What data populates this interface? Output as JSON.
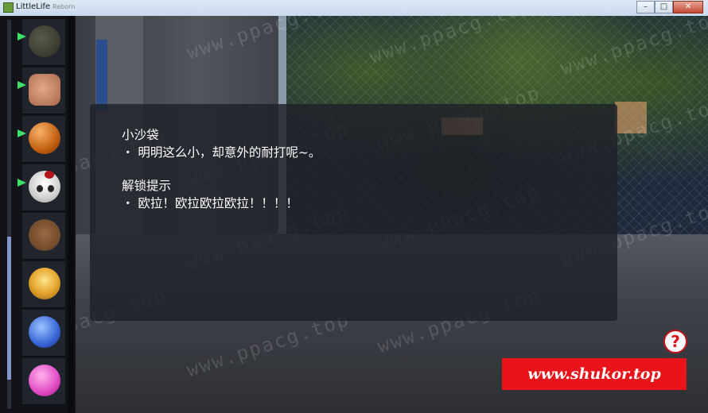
{
  "window": {
    "title": "LittleLife",
    "subtitle": "Reborn"
  },
  "sidebar": {
    "items": [
      {
        "icon": "helmet-icon",
        "unlocked": true
      },
      {
        "icon": "fist-icon",
        "unlocked": true
      },
      {
        "icon": "sandbag-ball-icon",
        "unlocked": true
      },
      {
        "icon": "skull-icon",
        "unlocked": true
      },
      {
        "icon": "teddy-bear-icon",
        "unlocked": false
      },
      {
        "icon": "explosion-icon",
        "unlocked": false
      },
      {
        "icon": "blue-face-icon",
        "unlocked": false
      },
      {
        "icon": "pink-face-icon",
        "unlocked": false
      }
    ],
    "scroll_fraction": 0.55
  },
  "message": {
    "item_name": "小沙袋",
    "description": "・ 明明这么小，却意外的耐打呢~。",
    "hint_title": "解锁提示",
    "hint_text": "・ 欧拉！欧拉欧拉欧拉！！！！"
  },
  "help_button": {
    "label": "说明"
  },
  "watermark_text": "www.ppacg.top",
  "banner_text": "www.shukor.top",
  "colors": {
    "unlock_arrow": "#3ee06a",
    "banner": "#e8141a",
    "help_ring": "#c0161c"
  }
}
